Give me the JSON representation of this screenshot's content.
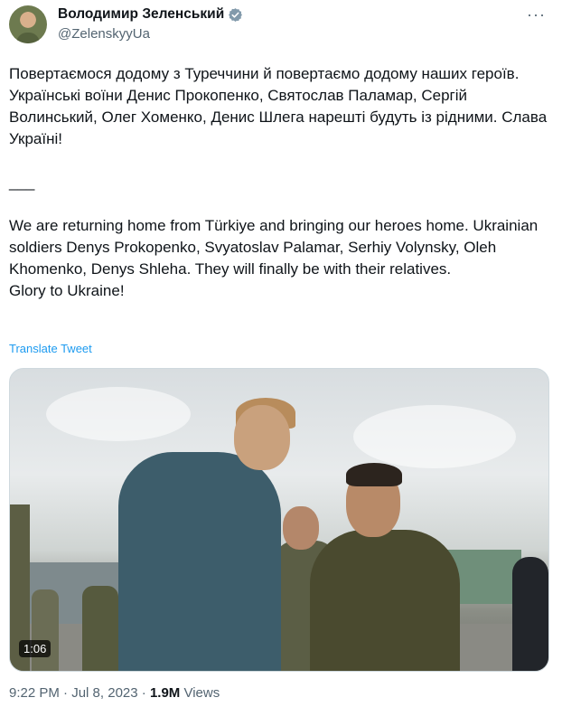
{
  "author": {
    "name": "Володимир Зеленський",
    "handle": "@ZelenskyyUa",
    "verified": true
  },
  "tweet": {
    "paragraphs": [
      "Повертаємося додому з Туреччини й повертаємо додому наших героїв. Українські воїни Денис Прокопенко, Святослав Паламар, Сергій Волинський, Олег Хоменко, Денис Шлега нарешті будуть із рідними. Слава Україні!",
      "___",
      "We are returning home from Türkiye and bringing our heroes home. Ukrainian soldiers Denys Prokopenko, Svyatoslav Palamar, Serhiy Volynsky, Oleh Khomenko, Denys Shleha. They will finally be with their relatives.",
      "Glory to Ukraine!"
    ],
    "translate_label": "Translate Tweet"
  },
  "media": {
    "type": "video",
    "duration": "1:06"
  },
  "meta": {
    "time": "9:22 PM",
    "separator1": " · ",
    "date": "Jul 8, 2023",
    "separator2": " · ",
    "views_count": "1.9M",
    "views_label": " Views"
  },
  "icons": {
    "verified": "verified-badge-icon",
    "more": "more-options-icon"
  },
  "colors": {
    "link": "#1d9bf0",
    "secondary_text": "#536471",
    "primary_text": "#0f1419",
    "verified_badge": "#829aab"
  }
}
